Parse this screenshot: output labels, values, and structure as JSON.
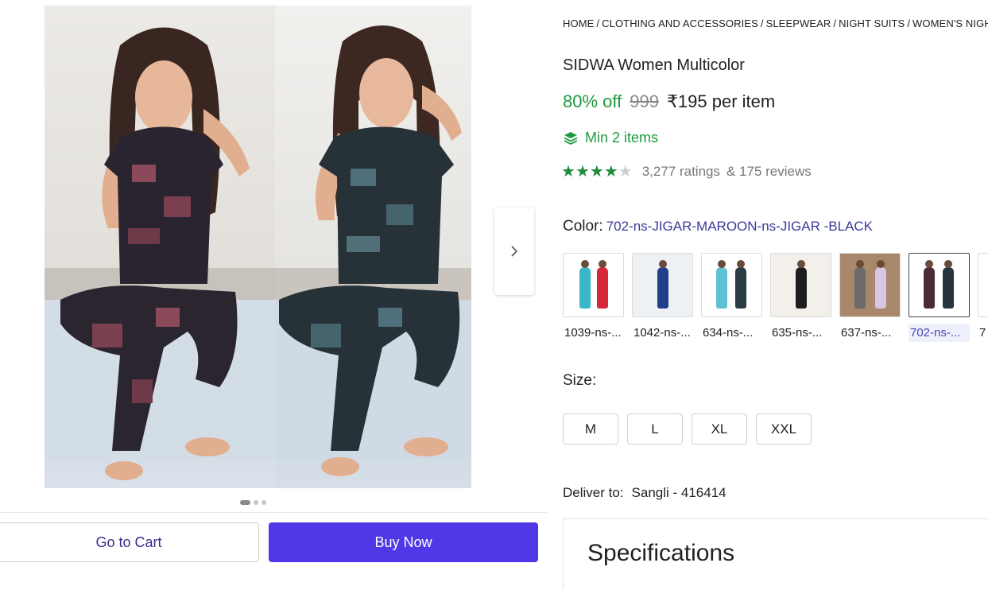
{
  "gallery": {
    "next_icon": "chevron-right-icon",
    "dots": 3,
    "active_dot": 0
  },
  "actions": {
    "cart_label": "Go to Cart",
    "buy_label": "Buy Now"
  },
  "breadcrumb": [
    "HOME",
    "CLOTHING AND ACCESSORIES",
    "SLEEPWEAR",
    "NIGHT SUITS",
    "WOMEN'S NIGHT SUITS"
  ],
  "product": {
    "title": "SIDWA Women Multicolor",
    "discount": "80% off",
    "mrp": "999",
    "price": "₹195 per item",
    "min_items": "Min 2 items",
    "min_items_icon": "layers-icon",
    "rating_stars": 4,
    "ratings": "3,277 ratings",
    "reviews": "& 175 reviews"
  },
  "color": {
    "label": "Color:",
    "selected": "702-ns-JIGAR-MAROON-ns-JIGAR -BLACK",
    "swatches": [
      {
        "label": "1039-ns-..."
      },
      {
        "label": "1042-ns-..."
      },
      {
        "label": "634-ns-..."
      },
      {
        "label": "635-ns-..."
      },
      {
        "label": "637-ns-..."
      },
      {
        "label": "702-ns-..."
      },
      {
        "label": "7"
      }
    ]
  },
  "size": {
    "label": "Size:",
    "options": [
      "M",
      "L",
      "XL",
      "XXL"
    ]
  },
  "delivery": {
    "label": "Deliver to:",
    "location": "Sangli - 416414"
  },
  "specs": {
    "title": "Specifications"
  },
  "colors": {
    "accent": "#5138e6",
    "discount": "#1c9a3e",
    "star": "#1e8c3a",
    "link": "#3a3a9c"
  }
}
